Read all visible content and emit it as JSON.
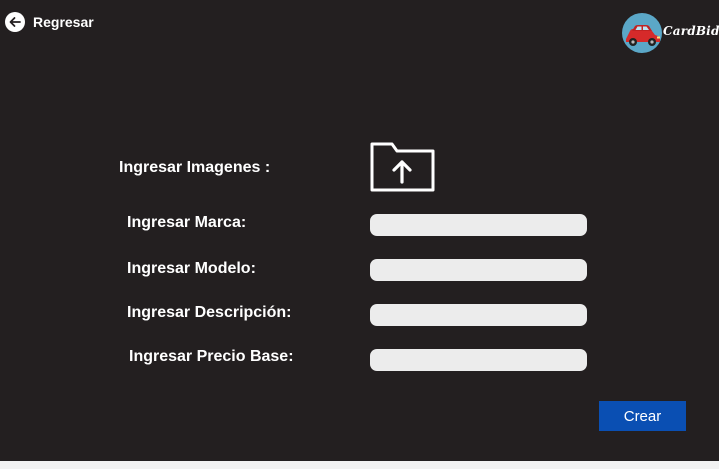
{
  "header": {
    "back_label": "Regresar",
    "back_icon": "arrow-left-icon",
    "logo_text": "CardBid",
    "logo_icon": "red-car-icon"
  },
  "form": {
    "images_label": "Ingresar Imagenes :",
    "upload_icon": "folder-upload-icon",
    "brand_label": "Ingresar Marca:",
    "brand_value": "",
    "model_label": "Ingresar Modelo:",
    "model_value": "",
    "description_label": "Ingresar Descripción:",
    "description_value": "",
    "price_label": "Ingresar Precio Base:",
    "price_value": "",
    "create_label": "Crear"
  },
  "colors": {
    "background": "#231f20",
    "accent": "#0a4fb3",
    "field": "#ececec",
    "logo_circle": "#5ba7c7"
  }
}
